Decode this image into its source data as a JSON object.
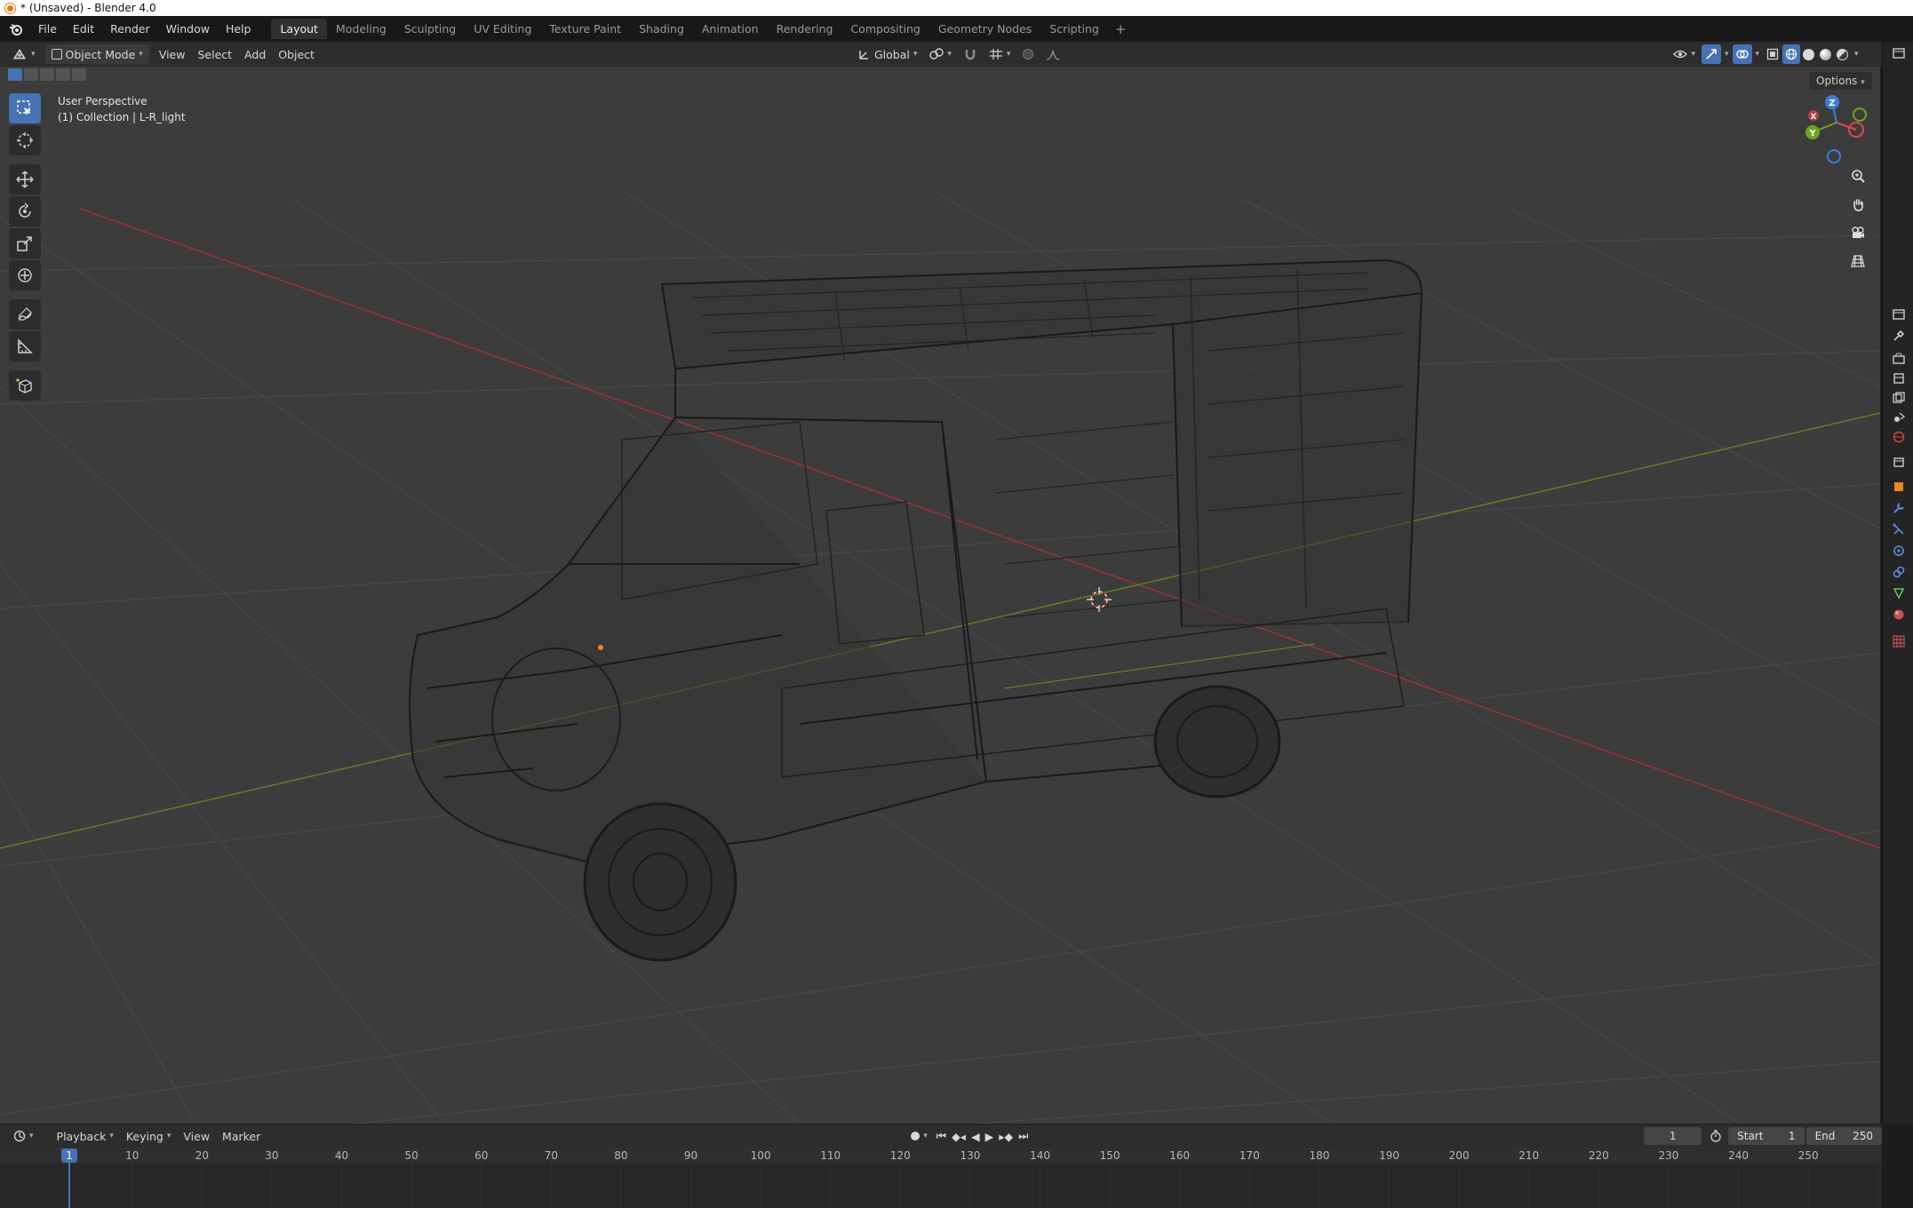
{
  "window": {
    "title": "* (Unsaved) - Blender 4.0"
  },
  "menus": [
    "File",
    "Edit",
    "Render",
    "Window",
    "Help"
  ],
  "workspaces": [
    {
      "label": "Layout",
      "active": true
    },
    {
      "label": "Modeling",
      "active": false
    },
    {
      "label": "Sculpting",
      "active": false
    },
    {
      "label": "UV Editing",
      "active": false
    },
    {
      "label": "Texture Paint",
      "active": false
    },
    {
      "label": "Shading",
      "active": false
    },
    {
      "label": "Animation",
      "active": false
    },
    {
      "label": "Rendering",
      "active": false
    },
    {
      "label": "Compositing",
      "active": false
    },
    {
      "label": "Geometry Nodes",
      "active": false
    },
    {
      "label": "Scripting",
      "active": false
    }
  ],
  "workspace_add": "+",
  "viewport_header": {
    "mode": "Object Mode",
    "menus": [
      "View",
      "Select",
      "Add",
      "Object"
    ],
    "orientation": "Global",
    "options_label": "Options"
  },
  "viewport": {
    "perspective": "User Perspective",
    "collection": "(1) Collection | L-R_light"
  },
  "gizmo": {
    "x_label": "X",
    "y_label": "Y",
    "z_label": "Z",
    "colors": {
      "x": "#e0484f",
      "y": "#6ea61f",
      "z": "#3c7fd8"
    }
  },
  "timeline": {
    "menus": [
      "Playback",
      "Keying",
      "View",
      "Marker"
    ],
    "current_frame": "1",
    "start_label": "Start",
    "start_value": "1",
    "end_label": "End",
    "end_value": "250",
    "ruler_labels": [
      "1",
      "10",
      "20",
      "30",
      "40",
      "50",
      "60",
      "70",
      "80",
      "90",
      "100",
      "110",
      "120",
      "130",
      "140",
      "150",
      "160",
      "170",
      "180",
      "190",
      "200",
      "210",
      "220",
      "230",
      "240",
      "250"
    ]
  },
  "colors": {
    "accent": "#4772b3",
    "x_axis": "#b33a3a",
    "y_axis": "#6b8e23",
    "background": "#3c3c3c"
  }
}
